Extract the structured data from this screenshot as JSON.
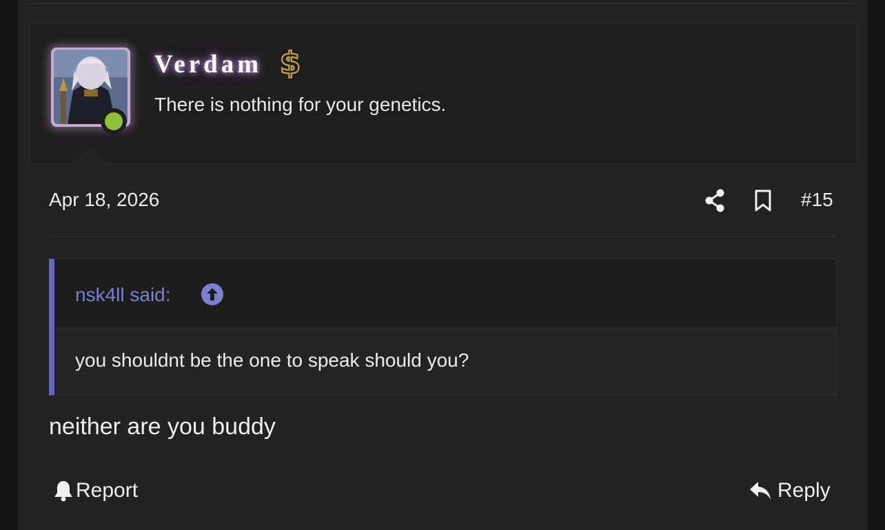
{
  "post": {
    "author": {
      "username": "Verdam",
      "user_title": "There is nothing for your genetics.",
      "status": "online",
      "badge_icon": "dollar-icon"
    },
    "meta": {
      "date": "Apr 18, 2026",
      "post_number": "#15"
    },
    "quote": {
      "attribution": "nsk4ll said:",
      "text": "you shouldnt be the one to speak should you?"
    },
    "body": "neither are you buddy",
    "actions": {
      "report_label": "Report",
      "reply_label": "Reply"
    }
  },
  "colors": {
    "accent": "#6467c0",
    "online": "#8fbf3a",
    "badge_gold": "#c9a24a"
  }
}
